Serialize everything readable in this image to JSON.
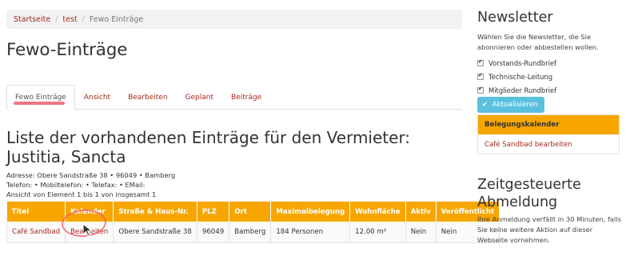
{
  "breadcrumb": {
    "items": [
      "Startseite",
      "test"
    ],
    "current": "Fewo Einträge"
  },
  "page_title": "Fewo-Einträge",
  "tabs": [
    {
      "label": "Fewo Einträge",
      "active": true
    },
    {
      "label": "Ansicht",
      "active": false
    },
    {
      "label": "Bearbeiten",
      "active": false
    },
    {
      "label": "Geplant",
      "active": false
    },
    {
      "label": "Beiträge",
      "active": false
    }
  ],
  "list": {
    "heading": "Liste der vorhandenen Einträge für den Vermieter: Justitia, Sancta",
    "address": "Adresse: Obere Sandstraße 38 • 96049 • Bamberg",
    "contact": "Telefon: • Mobiltelefon: • Telefax: • EMail:",
    "range": "Ansicht von Element 1 bis 1 von insgesamt 1"
  },
  "table": {
    "headers": [
      "Titel",
      "Kalender",
      "Straße & Haus-Nr.",
      "PLZ",
      "Ort",
      "Maximalbelegung",
      "Wohnfläche",
      "Aktiv",
      "Veröffentlicht"
    ],
    "rows": [
      [
        "Café Sandbad",
        "Bearbeiten",
        "Obere Sandstraße 38",
        "96049",
        "Bamberg",
        "184 Personen",
        "12.00 m²",
        "Nein",
        "Nein"
      ]
    ]
  },
  "sidebar": {
    "newsletter": {
      "title": "Newsletter",
      "description": "Wählen Sie die Newsletter, die Sie abonnieren oder abbestellen wollen.",
      "options": [
        {
          "label": "Vorstands-Rundbrief",
          "checked": true
        },
        {
          "label": "Technische-Leitung",
          "checked": true
        },
        {
          "label": "Mitglieder Rundbrief",
          "checked": true
        }
      ],
      "button": "Aktualisieren"
    },
    "calendar": {
      "title": "Belegungskalender",
      "link": "Café Sandbad bearbeiten"
    },
    "abmeldung": {
      "title": "Zeitgesteuerte Abmeldung",
      "description": "Ihre Anmeldung verfällt in 30 Minuten, falls Sie keine weitere Aktion auf dieser Webseite vornehmen."
    }
  },
  "colors": {
    "accent": "#f7a600",
    "link": "#a5281b",
    "button": "#5bc0de",
    "annotation": "#f05a6e"
  }
}
